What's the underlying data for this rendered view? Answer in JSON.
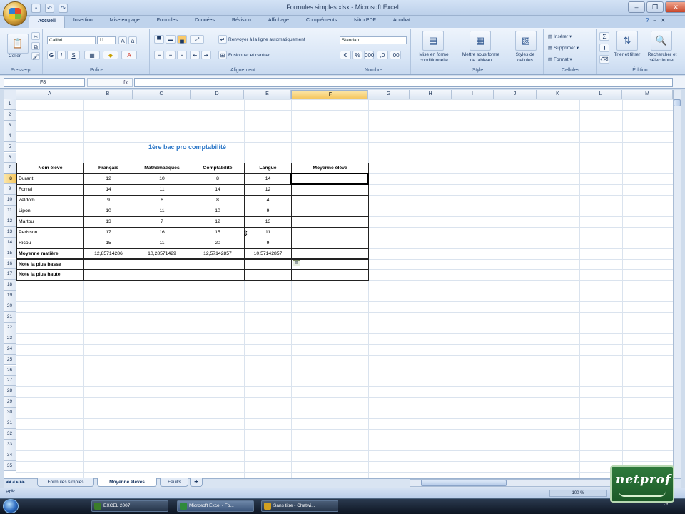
{
  "window": {
    "title": "Formules simples.xlsx - Microsoft Excel"
  },
  "ribbon_tabs": [
    "Accueil",
    "Insertion",
    "Mise en page",
    "Formules",
    "Données",
    "Révision",
    "Affichage",
    "Compléments",
    "Nitro PDF",
    "Acrobat"
  ],
  "ribbon": {
    "clipboard": {
      "paste": "Coller",
      "label": "Presse-p..."
    },
    "font": {
      "name": "Calibri",
      "size": "11",
      "label": "Police"
    },
    "alignment": {
      "wrap": "Renvoyer à la ligne automatiquement",
      "merge": "Fusionner et centrer",
      "label": "Alignement"
    },
    "number": {
      "format": "Standard",
      "label": "Nombre"
    },
    "style": {
      "cond": "Mise en forme conditionnelle",
      "table": "Mettre sous forme de tableau",
      "cell": "Styles de cellules",
      "label": "Style"
    },
    "cells": {
      "insert": "Insérer",
      "delete": "Supprimer",
      "format": "Format",
      "label": "Cellules"
    },
    "editing": {
      "sort": "Trier et filtrer",
      "find": "Rechercher et sélectionner",
      "label": "Édition"
    }
  },
  "formula_bar": {
    "name_box": "F8",
    "fx": "fx",
    "value": ""
  },
  "columns": [
    "A",
    "B",
    "C",
    "D",
    "E",
    "F",
    "G",
    "H",
    "I",
    "J",
    "K",
    "L",
    "M"
  ],
  "active_column": "F",
  "active_row": 8,
  "rows": [
    "1",
    "2",
    "3",
    "4",
    "5",
    "6",
    "7",
    "8",
    "9",
    "10",
    "11",
    "12",
    "13",
    "14",
    "15",
    "16",
    "17",
    "18",
    "19",
    "20",
    "21",
    "22",
    "23",
    "24",
    "25",
    "26",
    "27",
    "28",
    "29",
    "30",
    "31",
    "32",
    "33",
    "34",
    "35"
  ],
  "sheet": {
    "title": "1ère bac pro comptabilité",
    "headers": [
      "Nom élève",
      "Français",
      "Mathématiques",
      "Comptabilité",
      "Langue",
      "Moyenne élève"
    ],
    "students": [
      {
        "name": "Durant",
        "vals": [
          "12",
          "10",
          "8",
          "14"
        ]
      },
      {
        "name": "Fornel",
        "vals": [
          "14",
          "11",
          "14",
          "12"
        ]
      },
      {
        "name": "Zeldom",
        "vals": [
          "9",
          "6",
          "8",
          "4"
        ]
      },
      {
        "name": "Lipon",
        "vals": [
          "10",
          "11",
          "10",
          "9"
        ]
      },
      {
        "name": "Martou",
        "vals": [
          "13",
          "7",
          "12",
          "13"
        ]
      },
      {
        "name": "Perisson",
        "vals": [
          "17",
          "16",
          "15",
          "11"
        ]
      },
      {
        "name": "Ricou",
        "vals": [
          "15",
          "11",
          "20",
          "9"
        ]
      }
    ],
    "summary": [
      {
        "label": "Moyenne matière",
        "vals": [
          "12,85714286",
          "10,28571429",
          "12,57142857",
          "10,57142857"
        ]
      },
      {
        "label": "Note la plus basse",
        "vals": [
          "",
          "",
          "",
          ""
        ]
      },
      {
        "label": "Note la plus haute",
        "vals": [
          "",
          "",
          "",
          ""
        ]
      }
    ]
  },
  "sheet_tabs": [
    "Formules simples",
    "Moyenne élèves",
    "Feuil3"
  ],
  "active_sheet_tab": "Moyenne élèves",
  "status": {
    "text": "Prêt",
    "zoom": "100 %"
  },
  "taskbar": {
    "items": [
      "EXCEL 2007",
      "Microsoft Excel - Fo...",
      "Sans titre - Chatwi..."
    ],
    "active": "Microsoft Excel - Fo..."
  },
  "logo": {
    "text": "netprof"
  }
}
